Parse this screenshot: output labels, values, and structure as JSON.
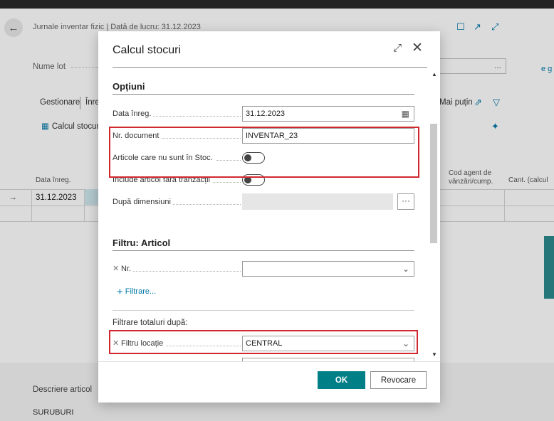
{
  "background": {
    "breadcrumb": "Jurnale inventar fizic | Dată de lucru: 31.12.2023",
    "batch_label": "Nume lot",
    "batch_value": "...",
    "side_link": "e g",
    "tab_manage": "Gestionare",
    "tab_second": "Înre",
    "more_less": "Mai puțin",
    "action_calc": "Calcul stocuri",
    "grid": {
      "col_date": "Data înreg.",
      "col_agent": "Cod agent de vânzări/cump.",
      "col_qty": "Cant. (calcul",
      "row_date": "31.12.2023"
    },
    "desc_label": "Descriere articol",
    "desc_value": "SURUBURI"
  },
  "dialog": {
    "title": "Calcul stocuri",
    "options": {
      "section_title": "Opțiuni",
      "posting_date_label": "Data înreg.",
      "posting_date_value": "31.12.2023",
      "doc_no_label": "Nr. document",
      "doc_no_value": "INVENTAR_23",
      "items_not_in_stock_label": "Articole care nu sunt în Stoc.",
      "items_not_in_stock_value": false,
      "include_no_tx_label": "Include articol fără tranzacții",
      "include_no_tx_value": false,
      "by_dimensions_label": "După dimensiuni",
      "by_dimensions_value": ""
    },
    "filter": {
      "section_title": "Filtru: Articol",
      "no_label": "Nr.",
      "no_value": "",
      "add_filter": "Filtrare...",
      "totals_heading": "Filtrare totaluri după:",
      "location_label": "Filtru locație",
      "location_value": "CENTRAL"
    },
    "ok_label": "OK",
    "cancel_label": "Revocare"
  }
}
